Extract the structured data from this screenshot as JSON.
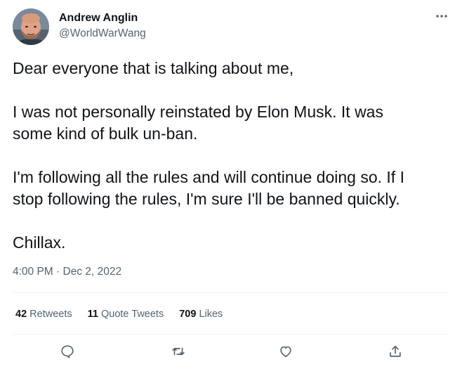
{
  "author": {
    "name": "Andrew Anglin",
    "handle": "@WorldWarWang"
  },
  "tweet": {
    "paragraphs": [
      [
        "Dear everyone that is talking about me,"
      ],
      [
        "I was not personally reinstated by Elon Musk. It was",
        "some kind of bulk un-ban."
      ],
      [
        "I'm following all the rules and will continue doing so. If I",
        "stop following the rules, I'm sure I'll be banned quickly."
      ],
      [
        "Chillax."
      ]
    ],
    "timestamp": "4:00 PM · Dec 2, 2022"
  },
  "stats": {
    "retweets": {
      "count": "42",
      "label": "Retweets"
    },
    "quote_tweets": {
      "count": "11",
      "label": "Quote Tweets"
    },
    "likes": {
      "count": "709",
      "label": "Likes"
    }
  },
  "icons": {
    "more": "more-horizontal-icon",
    "reply": "reply-icon",
    "retweet": "retweet-icon",
    "like": "heart-icon",
    "share": "share-icon"
  },
  "colors": {
    "text": "#0f1419",
    "secondary": "#536471",
    "divider": "#eff3f4"
  }
}
